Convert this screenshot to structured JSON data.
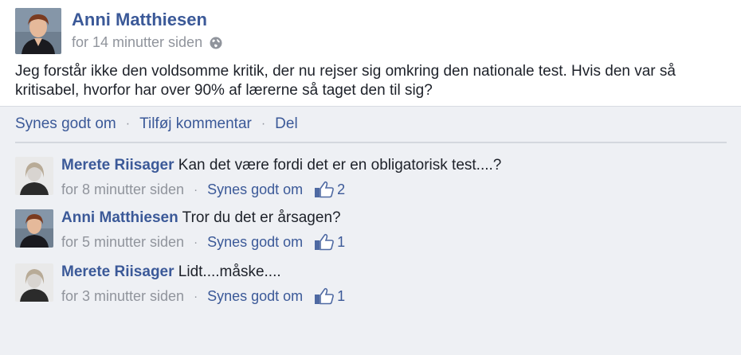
{
  "post": {
    "author": "Anni Matthiesen",
    "time": "for 14 minutter siden",
    "text": "Jeg forstår ikke den voldsomme kritik, der nu rejser sig omkring den nationale test. Hvis den var så kritisabel, hvorfor har over 90% af lærerne så taget den til sig?",
    "globe_icon": "globe-icon"
  },
  "actions": {
    "like": "Synes godt om",
    "comment": "Tilføj kommentar",
    "share": "Del",
    "separator": "·"
  },
  "comments": [
    {
      "author": "Merete Riisager",
      "text": "Kan det være fordi det er en obligatorisk test....?",
      "time": "for 8 minutter siden",
      "like_label": "Synes godt om",
      "like_count": "2"
    },
    {
      "author": "Anni Matthiesen",
      "text": "Tror du det er årsagen?",
      "time": "for 5 minutter siden",
      "like_label": "Synes godt om",
      "like_count": "1"
    },
    {
      "author": "Merete Riisager",
      "text": "Lidt....måske....",
      "time": "for 3 minutter siden",
      "like_label": "Synes godt om",
      "like_count": "1"
    }
  ],
  "colors": {
    "link": "#3b5998",
    "meta": "#90949c",
    "text": "#1d2129",
    "background": "#eef0f4"
  }
}
